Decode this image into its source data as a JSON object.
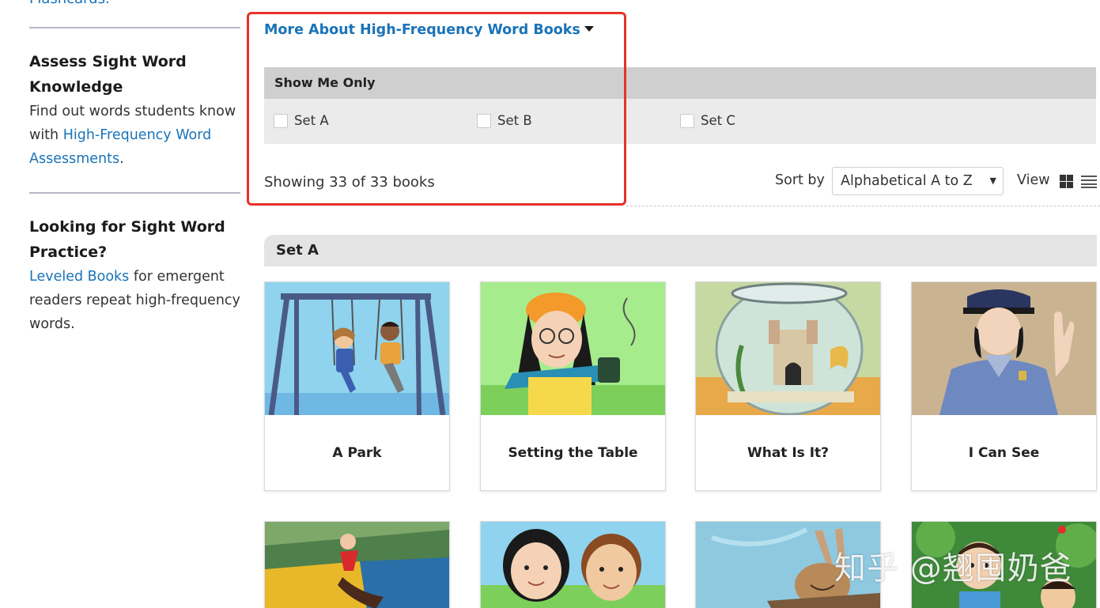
{
  "sidebar": {
    "partial_link": "Flashcards.",
    "assess": {
      "heading": "Assess Sight Word Knowledge",
      "text_before": "Find out words students know with ",
      "link": "High-Frequency Word Assessments",
      "text_after": "."
    },
    "practice": {
      "heading": "Looking for Sight Word Practice?",
      "link": "Leveled Books",
      "text_after": " for emergent readers repeat high-frequency words."
    }
  },
  "main": {
    "more_about": "More About High-Frequency Word Books",
    "filter": {
      "title": "Show Me Only",
      "options": [
        "Set A",
        "Set B",
        "Set C"
      ]
    },
    "showing": "Showing 33 of 33 books",
    "sort_label": "Sort by",
    "sort_value": "Alphabetical A to Z",
    "view_label": "View",
    "set_header": "Set A",
    "books": [
      {
        "title": "A Park",
        "icon": "swing-illustration"
      },
      {
        "title": "Setting the Table",
        "icon": "girl-with-mug-illustration"
      },
      {
        "title": "What Is It?",
        "icon": "fishbowl-castle-illustration"
      },
      {
        "title": "I Can See",
        "icon": "police-officer-illustration"
      }
    ],
    "books_row2_icons": [
      "runner-illustration",
      "two-children-illustration",
      "rabbit-in-boat-illustration",
      "boy-in-garden-illustration"
    ]
  },
  "watermark": "知乎 @翘囤奶爸",
  "colors": {
    "link": "#1a73b8",
    "highlight_box": "#e8312a",
    "filter_head": "#cfcfcf",
    "filter_body": "#ebebeb"
  }
}
